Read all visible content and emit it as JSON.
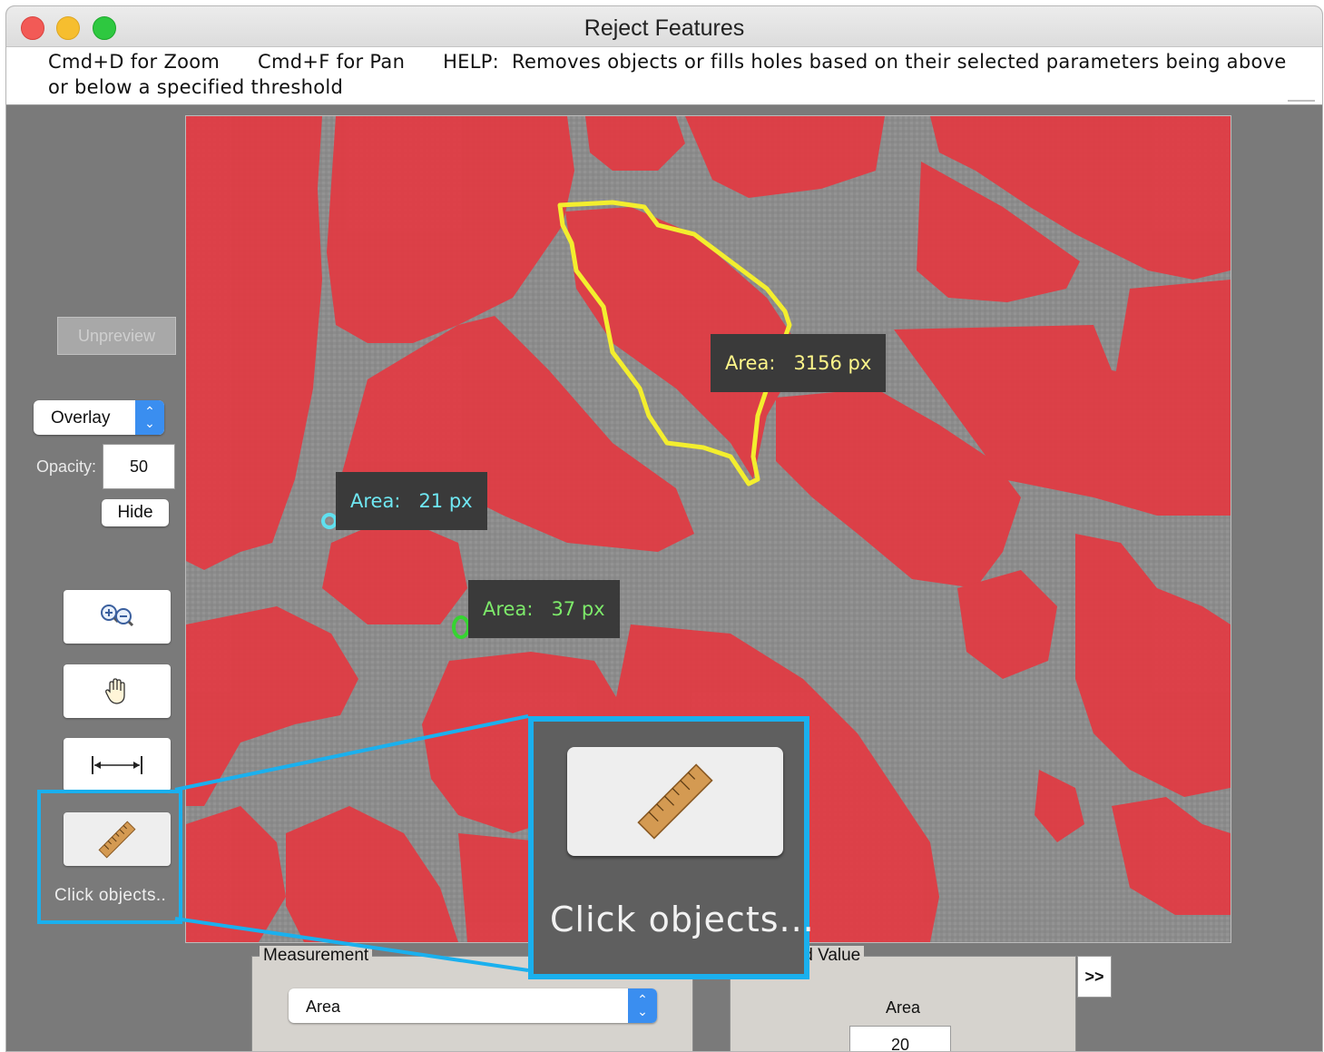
{
  "window": {
    "title": "Reject Features"
  },
  "help": {
    "zoom_hint": "Cmd+D for Zoom",
    "pan_hint": "Cmd+F for Pan",
    "text_line1": "HELP:  Removes objects or fills holes based on their selected parameters being above",
    "text_line2": "or below a specified threshold"
  },
  "left_panel": {
    "unpreview_label": "Unpreview",
    "display_mode": "Overlay",
    "opacity_label": "Opacity:",
    "opacity_value": "50",
    "hide_label": "Hide",
    "tools": [
      {
        "name": "zoom",
        "icon": "zoom-in-out-icon"
      },
      {
        "name": "pan",
        "icon": "hand-icon"
      },
      {
        "name": "measure-distance",
        "icon": "distance-arrow-icon"
      },
      {
        "name": "measure-object",
        "icon": "ruler-icon"
      }
    ],
    "click_objects_label": "Click objects.."
  },
  "image": {
    "tooltips": [
      {
        "label": "Area:",
        "value": "3156 px",
        "color": "#fff78a"
      },
      {
        "label": "Area:",
        "value": "21 px",
        "color": "#6fe7f2"
      },
      {
        "label": "Area:",
        "value": "37 px",
        "color": "#7dea6a"
      }
    ],
    "overlay_color": "#e03c44",
    "background_color": "#8e8e8e"
  },
  "callout": {
    "label": "Click objects...",
    "color": "#1ab0ee"
  },
  "measurement": {
    "legend": "Measurement",
    "selected": "Area"
  },
  "threshold": {
    "legend": "ld Value",
    "param_label": "Area",
    "value": "20",
    "more_label": ">>"
  }
}
